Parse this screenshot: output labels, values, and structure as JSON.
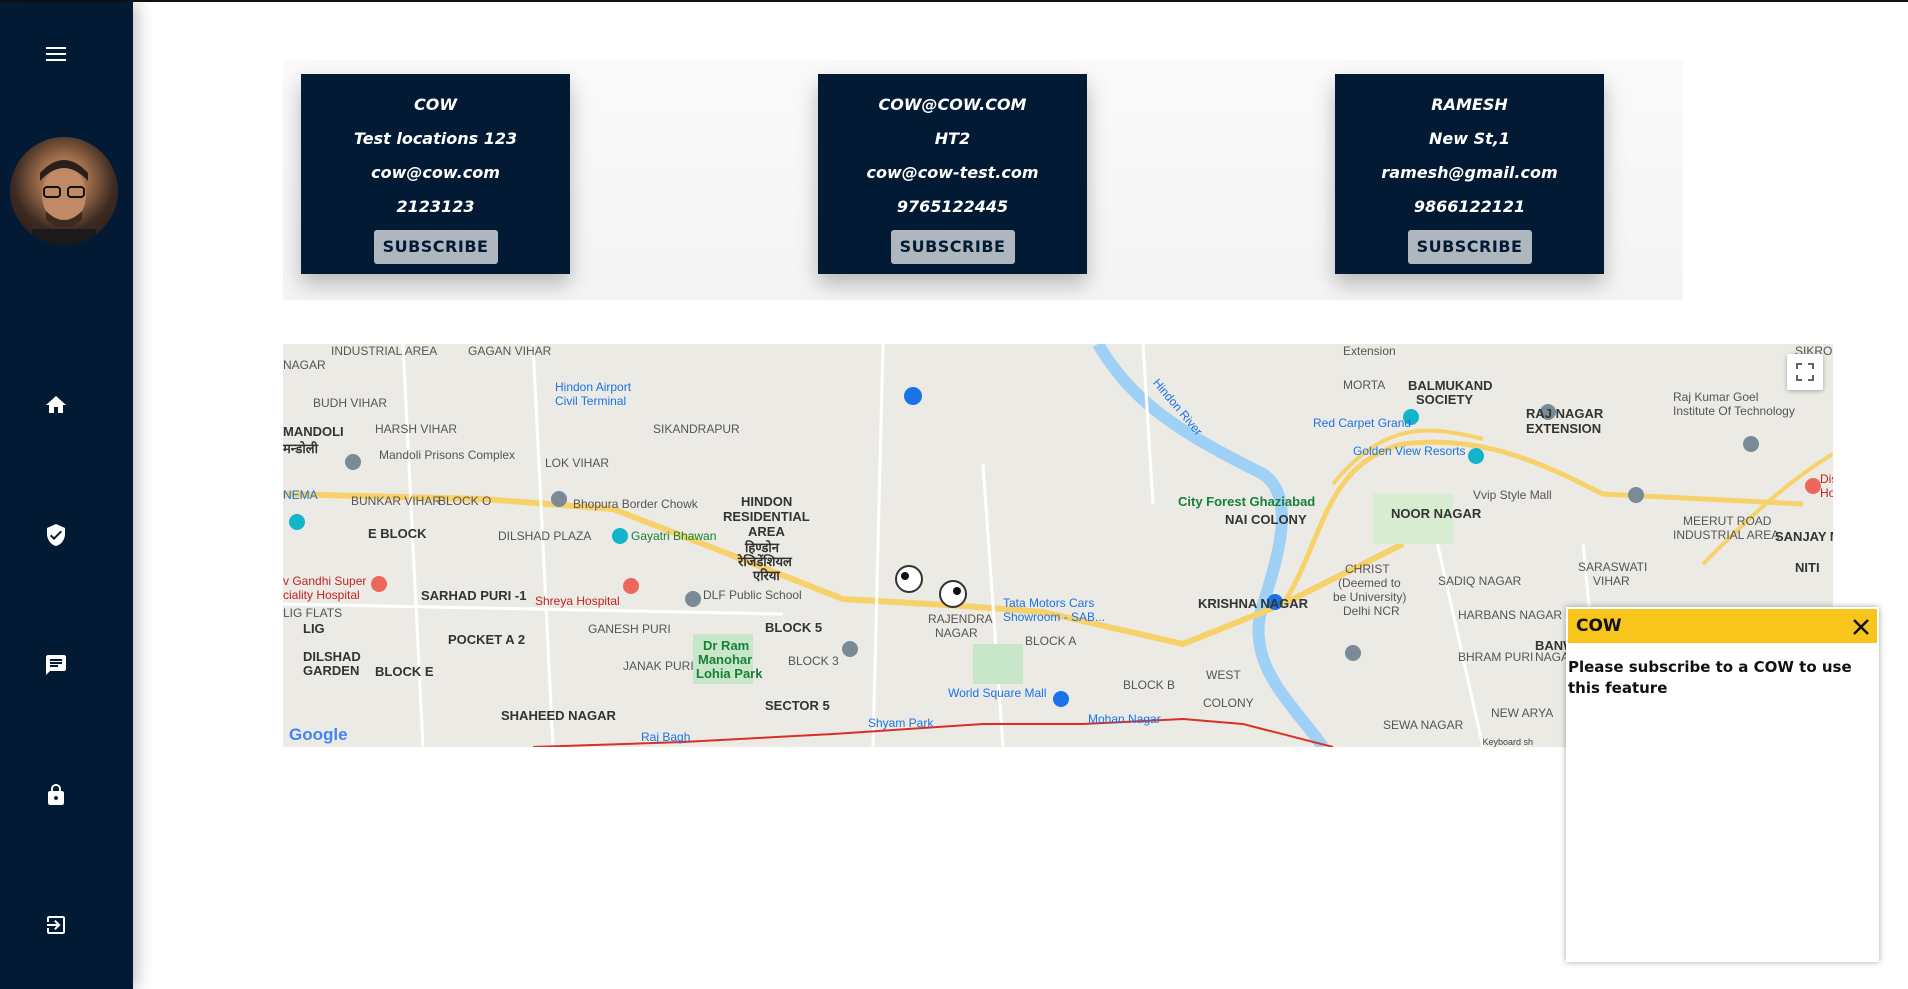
{
  "sidebar": {
    "menu_icon": "hamburger-menu-icon",
    "avatar": "user-avatar",
    "nav": [
      {
        "icon": "home-icon"
      },
      {
        "icon": "shield-check-icon"
      },
      {
        "icon": "message-icon"
      },
      {
        "icon": "lock-icon"
      },
      {
        "icon": "logout-icon"
      }
    ],
    "bg_color": "#021a33"
  },
  "cards": [
    {
      "name": "COW",
      "location": "Test locations 123",
      "email": "cow@cow.com",
      "phone": "2123123",
      "button": "SUBSCRIBE"
    },
    {
      "name": "COW@COW.COM",
      "location": "HT2",
      "email": "cow@cow-test.com",
      "phone": "9765122445",
      "button": "SUBSCRIBE"
    },
    {
      "name": "RAMESH",
      "location": "New St,1",
      "email": "ramesh@gmail.com",
      "phone": "9866122121",
      "button": "SUBSCRIBE"
    }
  ],
  "map": {
    "labels": {
      "l1": "INDUSTRIAL AREA",
      "l2": "GAGAN VIHAR",
      "l3": "NAGAR",
      "l4": "BUDH VIHAR",
      "l5": "HARSH VIHAR",
      "l6": "MANDOLI",
      "l7": "मन्डोली",
      "l8": "Mandoli Prisons Complex",
      "l9": "LOK VIHAR",
      "l10": "Hindon Airport",
      "l11": "Civil Terminal",
      "l12": "SIKANDRAPUR",
      "l13": "BUNKAR VIHAR",
      "l14": "BLOCK O",
      "l15": "Bhopura Border Chowk",
      "l16": "HINDON",
      "l17": "RESIDENTIAL",
      "l18": "AREA",
      "l19": "हिण्डोन",
      "l20": "रेजिडेंशियल",
      "l21": "एरिया",
      "l22": "E BLOCK",
      "l23": "DILSHAD PLAZA",
      "l24": "Gayatri Bhawan",
      "l25": "NEMA",
      "l26": "v Gandhi Super",
      "l27": "ciality Hospital",
      "l28": "SARHAD PURI -1",
      "l29": "Shreya Hospital",
      "l30": "DLF Public School",
      "l31": "BLOCK 5",
      "l32": "LIG FLATS",
      "l33": "LIG",
      "l34": "POCKET A 2",
      "l35": "GANESH PURI",
      "l36": "Dr Ram",
      "l37": "Manohar",
      "l38": "Lohia Park",
      "l39": "DILSHAD",
      "l40": "GARDEN",
      "l41": "BLOCK E",
      "l42": "JANAK PURI",
      "l43": "SECTOR 5",
      "l44": "SHAHEED NAGAR",
      "l45": "Raj Bagh",
      "l46": "Shyam Park",
      "l47": "Tata Motors Cars",
      "l48": "Showroom - SAB...",
      "l49": "RAJENDRA",
      "l50": "NAGAR",
      "l51": "World Square Mall",
      "l52": "Mohan Nagar",
      "l53": "KRISHNA NAGAR",
      "l54": "City Forest Ghaziabad",
      "l55": "NAI COLONY",
      "l56": "Red Carpet Grand",
      "l57": "Golden View Resorts",
      "l58": "Vvip Style Mall",
      "l59": "BALMUKAND",
      "l60": "SOCIETY",
      "l61": "RAJ NAGAR",
      "l62": "EXTENSION",
      "l63": "NOOR NAGAR",
      "l64": "CHRIST",
      "l65": "(Deemed to",
      "l66": "be University)",
      "l67": "Delhi NCR",
      "l68": "SADIQ NAGAR",
      "l69": "Raj Kumar Goel",
      "l70": "Institute Of Technology",
      "l71": "MEERUT ROAD",
      "l72": "INDUSTRIAL AREA",
      "l73": "SANJAY N",
      "l74": "SARASWATI",
      "l75": "VIHAR",
      "l76": "HARBANS NAGAR",
      "l77": "BANWARI N",
      "l78": "BHRAM PURI",
      "l79": "NEW ARYA",
      "l80": "NAGAR",
      "l81": "SEWA NAGAR",
      "l82": "WEST",
      "l83": "COLONY",
      "l84": "MORTA",
      "l85": "Extension",
      "l86": "SIKROD",
      "l87": "Hindon River",
      "l88": "NITI",
      "l89": "BLOCK B",
      "l90": "BLOCK A",
      "l91": "BLOCK 3",
      "l92": "Dis",
      "l93": "Ho"
    },
    "google": "Google",
    "keyboard": "Keyboard sh"
  },
  "popup": {
    "title": "COW",
    "message": "Please subscribe to a COW to use this feature",
    "header_color": "#f7c51b"
  }
}
